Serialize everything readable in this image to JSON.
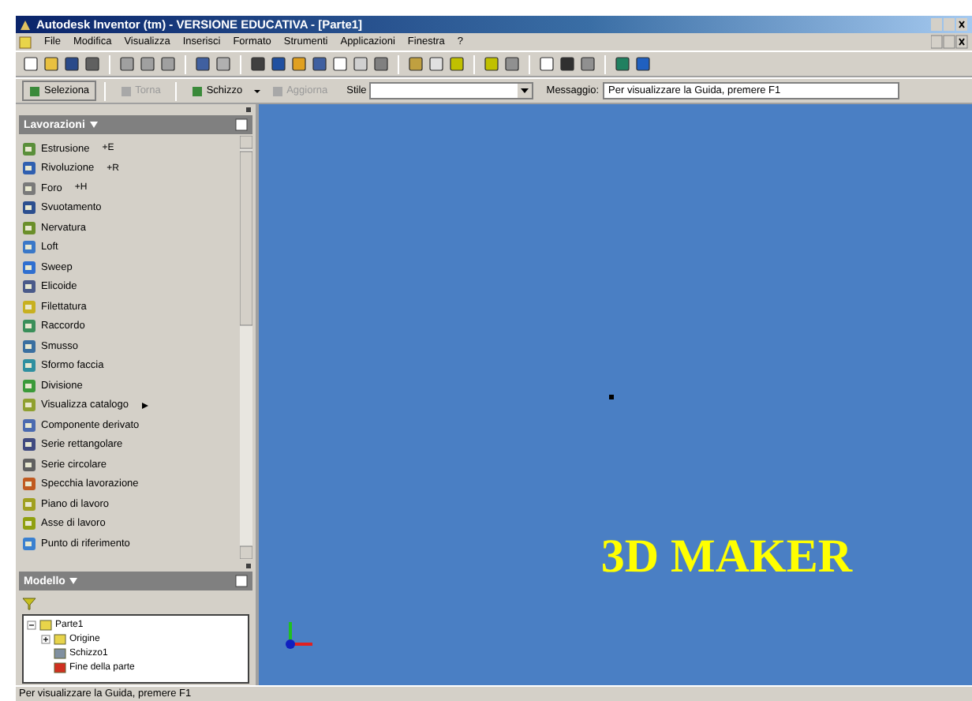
{
  "window": {
    "title": "Autodesk Inventor (tm) - VERSIONE EDUCATIVA - [Parte1]"
  },
  "menu": [
    "File",
    "Modifica",
    "Visualizza",
    "Inserisci",
    "Formato",
    "Strumenti",
    "Applicazioni",
    "Finestra",
    "?"
  ],
  "command_bar": {
    "select": {
      "label": "Seleziona",
      "disabled": false
    },
    "back": {
      "label": "Torna",
      "disabled": true
    },
    "sketch": {
      "label": "Schizzo",
      "disabled": false
    },
    "update": {
      "label": "Aggiorna",
      "disabled": true
    },
    "style_label": "Stile",
    "message_label": "Messaggio:",
    "message": "Per visualizzare la Guida, premere F1"
  },
  "features_panel": {
    "title": "Lavorazioni",
    "items": [
      {
        "label": "Estrusione",
        "shortcut": "+E"
      },
      {
        "label": "Rivoluzione",
        "shortcut": "+R"
      },
      {
        "label": "Foro",
        "shortcut": "+H"
      },
      {
        "label": "Svuotamento"
      },
      {
        "label": "Nervatura"
      },
      {
        "label": "Loft"
      },
      {
        "label": "Sweep"
      },
      {
        "label": "Elicoide"
      },
      {
        "label": "Filettatura"
      },
      {
        "label": "Raccordo"
      },
      {
        "label": "Smusso"
      },
      {
        "label": "Sformo faccia"
      },
      {
        "label": "Divisione"
      },
      {
        "label": "Visualizza catalogo",
        "submenu": true
      },
      {
        "label": "Componente derivato"
      },
      {
        "label": "Serie rettangolare"
      },
      {
        "label": "Serie circolare"
      },
      {
        "label": "Specchia lavorazione"
      },
      {
        "label": "Piano di lavoro"
      },
      {
        "label": "Asse di lavoro"
      },
      {
        "label": "Punto di riferimento"
      }
    ]
  },
  "model_panel": {
    "title": "Modello",
    "tree": [
      {
        "label": "Parte1",
        "expanded": true,
        "children": [
          {
            "label": "Origine",
            "expanded": false
          },
          {
            "label": "Schizzo1"
          },
          {
            "label": "Fine della parte"
          }
        ]
      }
    ]
  },
  "viewport": {
    "overlay": "3D MAKER"
  },
  "status_bar": "Per visualizzare la Guida, premere F1"
}
